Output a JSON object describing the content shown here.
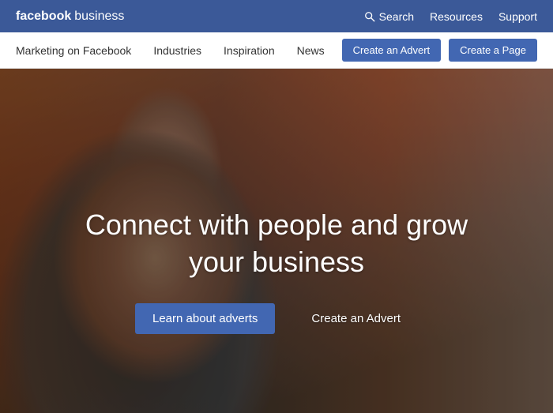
{
  "topBar": {
    "logo": {
      "facebook": "facebook",
      "business": "business"
    },
    "search_label": "Search",
    "resources_label": "Resources",
    "support_label": "Support"
  },
  "secondaryNav": {
    "items": [
      {
        "label": "Marketing on Facebook"
      },
      {
        "label": "Industries"
      },
      {
        "label": "Inspiration"
      },
      {
        "label": "News"
      }
    ],
    "btn_create_advert": "Create an Advert",
    "btn_create_page": "Create a Page"
  },
  "hero": {
    "title": "Connect with people and grow your business",
    "btn_learn": "Learn about adverts",
    "btn_create_advert": "Create an Advert"
  }
}
